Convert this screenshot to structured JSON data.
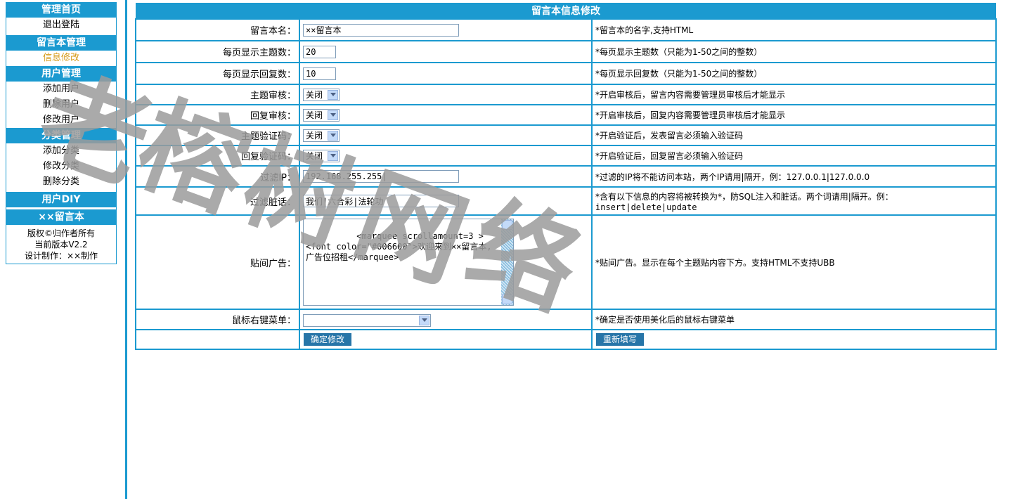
{
  "sidebar": {
    "groups": [
      {
        "title": "管理首页",
        "items": [
          "退出登陆"
        ]
      },
      {
        "title": "留言本管理",
        "items": [
          "信息修改"
        ]
      },
      {
        "title": "用户管理",
        "items": [
          "添加用户",
          "删除用户",
          "修改用户"
        ]
      },
      {
        "title": "分类管理",
        "items": [
          "添加分类",
          "修改分类",
          "删除分类"
        ]
      },
      {
        "title": "用户DIY",
        "items": []
      },
      {
        "title": "××留言本",
        "items": []
      }
    ],
    "active_item": "信息修改",
    "copyright": [
      "版权©归作者所有",
      "当前版本V2.2",
      "设计制作：××制作"
    ]
  },
  "form": {
    "title": "留言本信息修改",
    "rows": [
      {
        "label": "留言本名：",
        "value": "××留言本",
        "hint": "*留言本的名字,支持HTML"
      },
      {
        "label": "每页显示主题数：",
        "value": "20",
        "hint": "*每页显示主题数（只能为1-50之间的整数）"
      },
      {
        "label": "每页显示回复数：",
        "value": "10",
        "hint": "*每页显示回复数（只能为1-50之间的整数）"
      },
      {
        "label": "主题审核：",
        "value": "关闭",
        "hint": "*开启审核后，留言内容需要管理员审核后才能显示"
      },
      {
        "label": "回复审核：",
        "value": "关闭",
        "hint": "*开启审核后，回复内容需要管理员审核后才能显示"
      },
      {
        "label": "主题验证码：",
        "value": "关闭",
        "hint": "*开启验证后，发表留言必须输入验证码"
      },
      {
        "label": "回复验证码：",
        "value": "关闭",
        "hint": "*开启验证后，回复留言必须输入验证码"
      },
      {
        "label": "过滤IP：",
        "value": "192.168.255.255|",
        "hint": "*过滤的IP将不能访问本站，两个IP请用|隔开，例：127.0.0.1|127.0.0.0"
      },
      {
        "label": "过滤脏话：",
        "value": "我们|六合彩|法轮功",
        "hint": "*含有以下信息的内容将被转换为*，防SQL注入和脏话。两个词请用|隔开。例：",
        "hint2": "insert|delete|update"
      },
      {
        "label": "贴间广告：",
        "value": "<marquee scrollamount=3 ><font color=\"#006600\">欢迎来到××留言本,广告位招租</marquee>",
        "hint": "*贴间广告。显示在每个主题贴内容下方。支持HTML不支持UBB"
      },
      {
        "label": "鼠标右键菜单：",
        "value": "",
        "hint": "*确定是否使用美化后的鼠标右键菜单"
      }
    ],
    "submit_label": "确定修改",
    "reset_label": "重新填写"
  },
  "watermark": "老榕树网络",
  "colors": {
    "accent": "#1b9ad0",
    "active": "#d69b1a",
    "button": "#2775a8"
  }
}
